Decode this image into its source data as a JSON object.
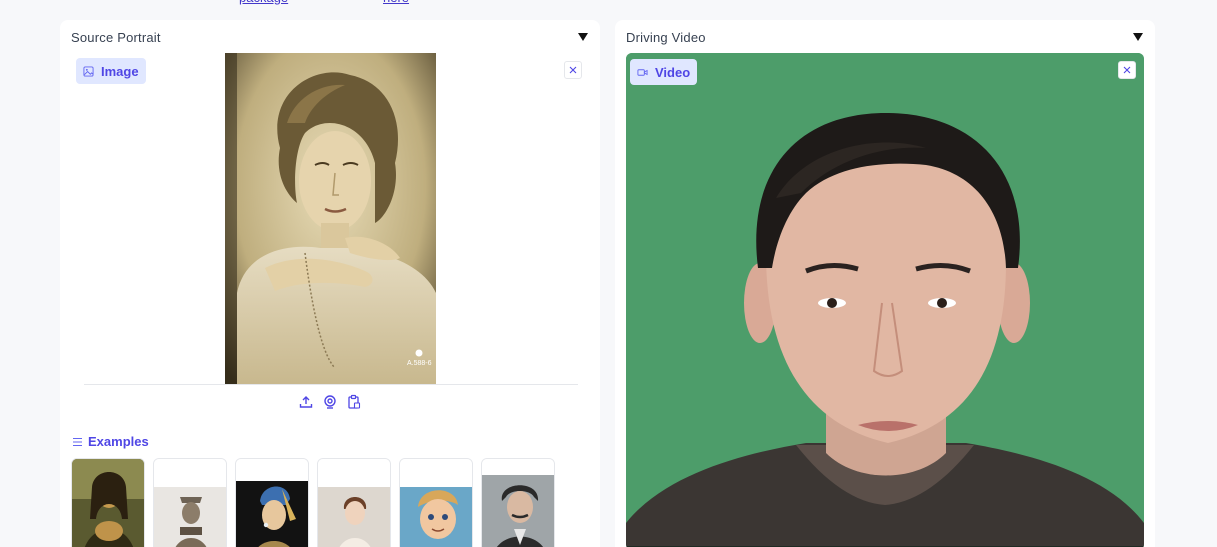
{
  "top_links": {
    "link1": "package",
    "link2": "here"
  },
  "source_panel": {
    "label": "Source Portrait",
    "badge": {
      "icon": "image-icon",
      "label": "Image"
    },
    "clear_icon": "close-icon",
    "portrait_caption": "A.588-6",
    "tools": [
      "upload-icon",
      "webcam-icon",
      "clipboard-icon"
    ],
    "examples": {
      "heading": "Examples",
      "items": [
        "mona-lisa",
        "terracotta-warrior",
        "girl-with-pearl-earring",
        "child-portrait",
        "cartoon-boy",
        "einstein"
      ]
    }
  },
  "driving_panel": {
    "label": "Driving Video",
    "badge": {
      "icon": "video-icon",
      "label": "Video"
    },
    "clear_icon": "close-icon"
  },
  "colors": {
    "accent": "#4f46e5",
    "badge_bg": "#e0e7ff",
    "green_screen": "#4d9d6a"
  }
}
